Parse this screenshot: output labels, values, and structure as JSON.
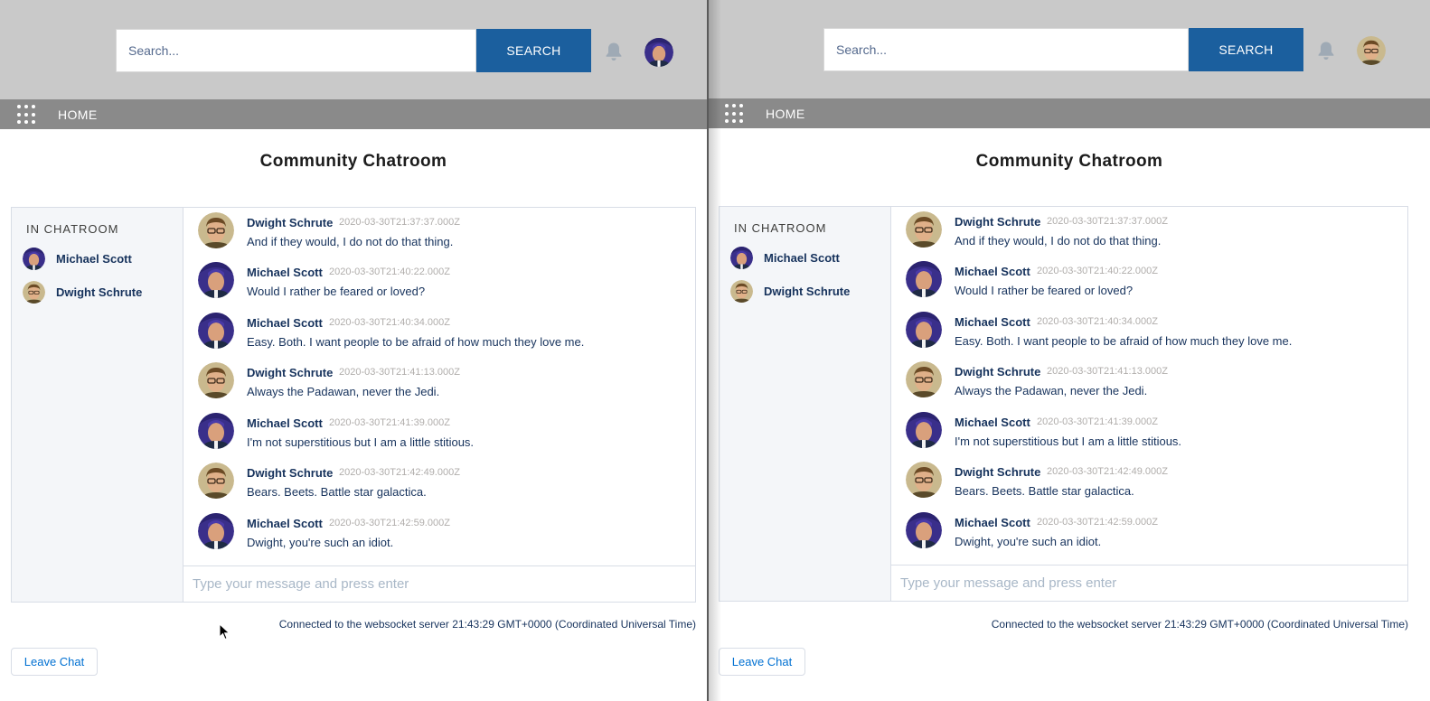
{
  "header": {
    "search_placeholder": "Search...",
    "search_button": "SEARCH"
  },
  "nav": {
    "home": "HOME"
  },
  "page": {
    "title": "Community Chatroom"
  },
  "sidebar": {
    "title": "IN CHATROOM",
    "members": [
      "Michael Scott",
      "Dwight Schrute"
    ]
  },
  "messages": [
    {
      "author": "Dwight Schrute",
      "timestamp": "2020-03-30T21:37:37.000Z",
      "text": "And if they would, I do not do that thing."
    },
    {
      "author": "Michael Scott",
      "timestamp": "2020-03-30T21:40:22.000Z",
      "text": "Would I rather be feared or loved?"
    },
    {
      "author": "Michael Scott",
      "timestamp": "2020-03-30T21:40:34.000Z",
      "text": "Easy. Both. I want people to be afraid of how much they love me."
    },
    {
      "author": "Dwight Schrute",
      "timestamp": "2020-03-30T21:41:13.000Z",
      "text": "Always the Padawan, never the Jedi."
    },
    {
      "author": "Michael Scott",
      "timestamp": "2020-03-30T21:41:39.000Z",
      "text": "I'm not superstitious but I am a little stitious."
    },
    {
      "author": "Dwight Schrute",
      "timestamp": "2020-03-30T21:42:49.000Z",
      "text": "Bears. Beets. Battle star galactica."
    },
    {
      "author": "Michael Scott",
      "timestamp": "2020-03-30T21:42:59.000Z",
      "text": "Dwight, you're such an idiot."
    }
  ],
  "composer": {
    "placeholder": "Type your message and press enter"
  },
  "status": "Connected to the websocket server 21:43:29 GMT+0000 (Coordinated Universal Time)",
  "leave_button": "Leave Chat",
  "icons": {
    "notifications": "bell-icon",
    "app_launcher": "waffle-icon",
    "avatar_michael": "avatar-purple",
    "avatar_dwight": "avatar-glasses"
  },
  "colors": {
    "header_bg": "#c9c9c9",
    "navbar_bg": "#8a8a8a",
    "search_button_bg": "#1b5f9e",
    "link": "#0070d2",
    "text": "#16325c",
    "timestamp": "#b0adab"
  }
}
